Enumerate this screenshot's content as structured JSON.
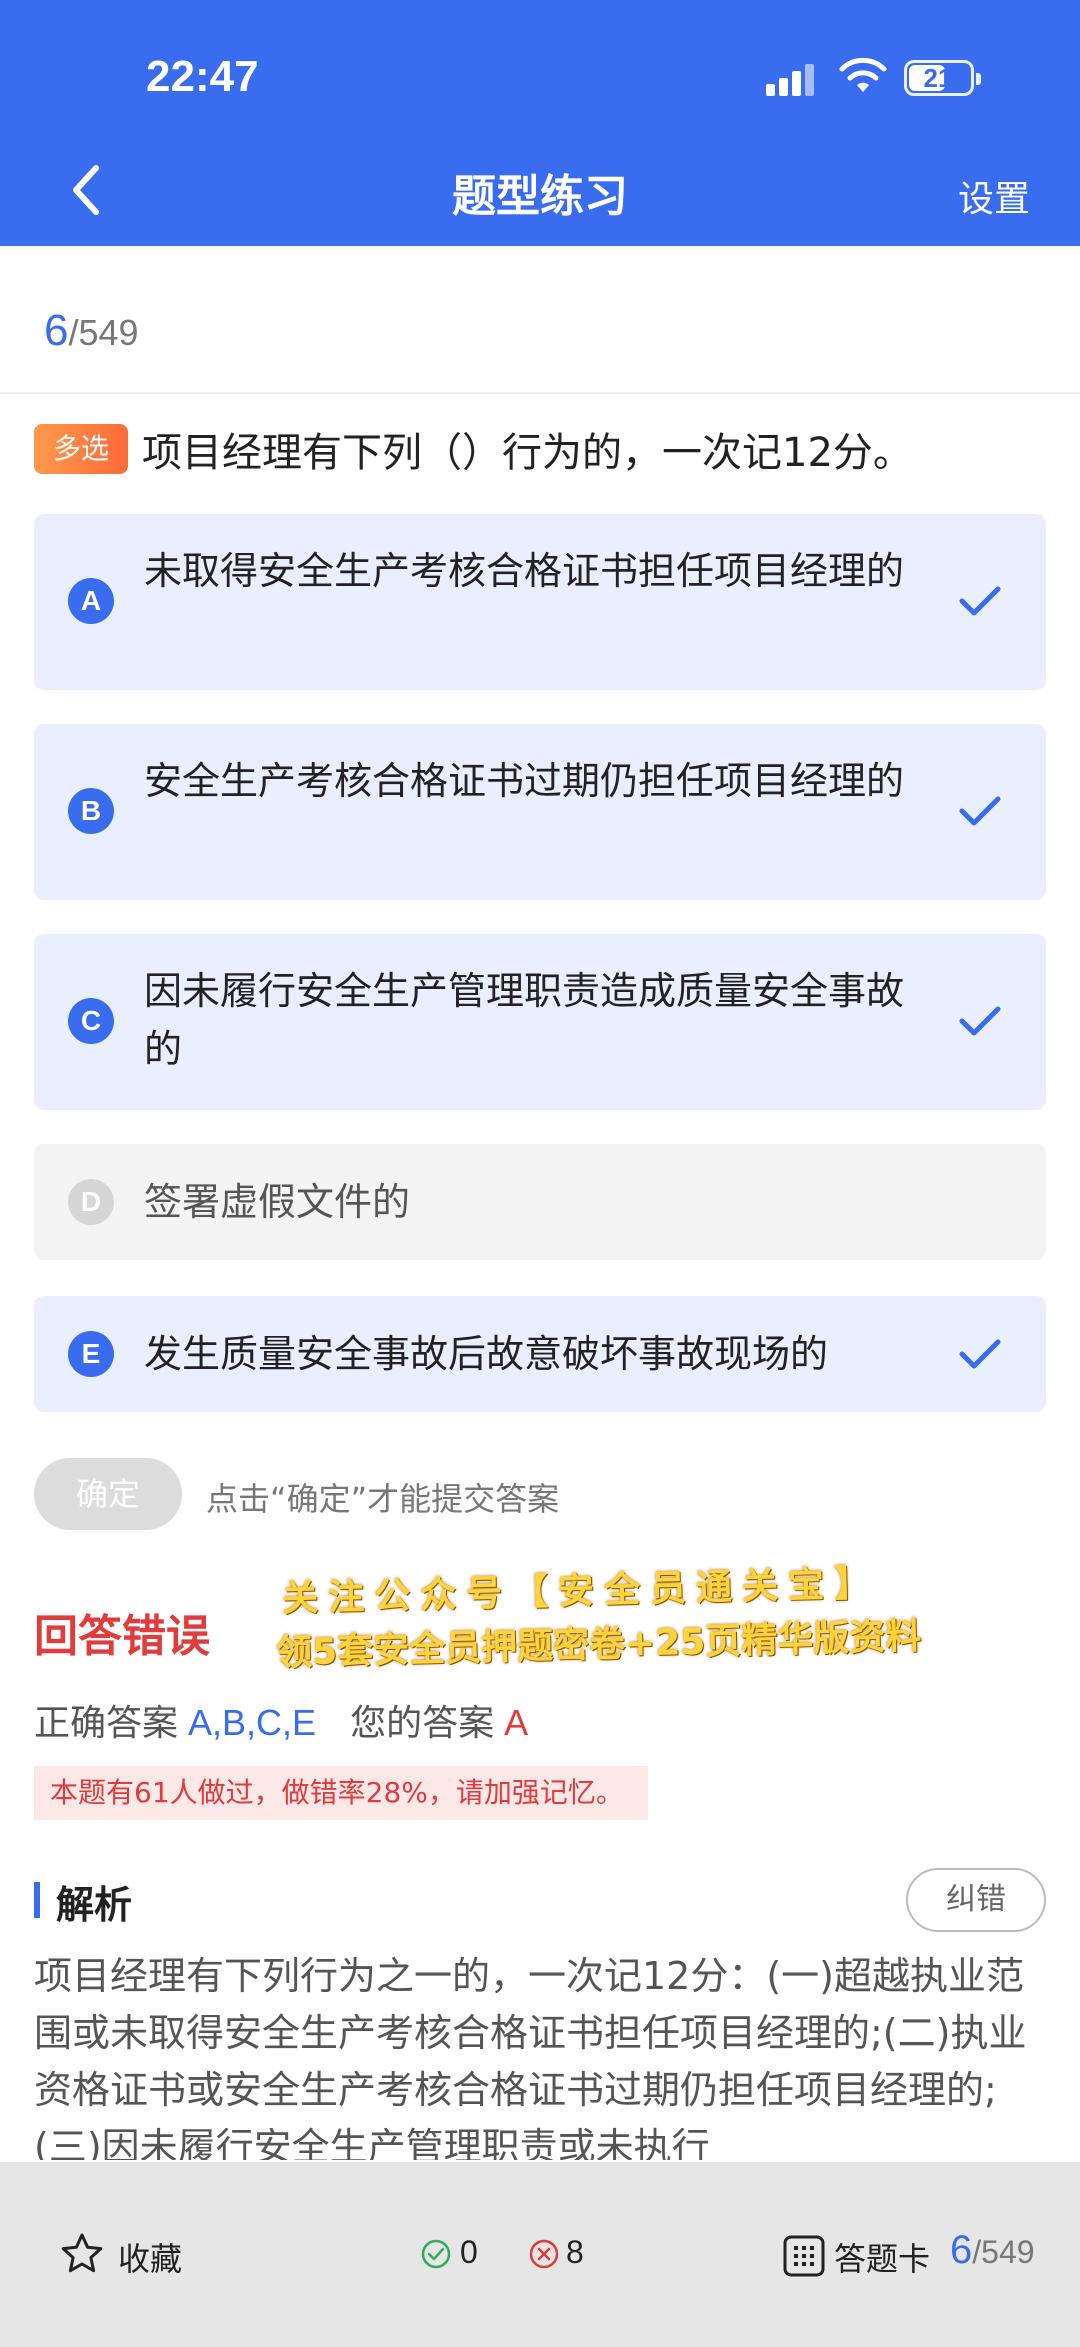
{
  "status": {
    "time": "22:47",
    "battery": "21"
  },
  "nav": {
    "title": "题型练习",
    "settings": "设置"
  },
  "progress": {
    "current": "6",
    "total": "/549"
  },
  "question": {
    "type": "多选",
    "text": "项目经理有下列（）行为的，一次记12分。",
    "options": [
      {
        "letter": "A",
        "text": "未取得安全生产考核合格证书担任项目经理的",
        "selected": true
      },
      {
        "letter": "B",
        "text": "安全生产考核合格证书过期仍担任项目经理的",
        "selected": true
      },
      {
        "letter": "C",
        "text": "因未履行安全生产管理职责造成质量安全事故的",
        "selected": true
      },
      {
        "letter": "D",
        "text": "签署虚假文件的",
        "selected": false
      },
      {
        "letter": "E",
        "text": "发生质量安全事故后故意破坏事故现场的",
        "selected": true
      }
    ]
  },
  "submit": {
    "button": "确定",
    "hint": "点击“确定”才能提交答案"
  },
  "result": {
    "title": "回答错误",
    "correct_label": "正确答案",
    "correct_value": "A,B,C,E",
    "mine_label": "您的答案",
    "mine_value": "A",
    "stat": "本题有61人做过，做错率28%，请加强记忆。"
  },
  "promo": {
    "line1": "关注公众号【安全员通关宝】",
    "line2": "领5套安全员押题密卷+25页精华版资料"
  },
  "analysis": {
    "title": "解析",
    "correct_button": "纠错",
    "text": "项目经理有下列行为之一的，一次记12分：(一)超越执业范围或未取得安全生产考核合格证书担任项目经理的;(二)执业资格证书或安全生产考核合格证书过期仍担任项目经理的;(三)因未履行安全生产管理职责或未执行"
  },
  "bottom": {
    "favorite": "收藏",
    "correct_count": "0",
    "wrong_count": "8",
    "answer_card": "答题卡",
    "current": "6",
    "total": "/549"
  },
  "colors": {
    "primary": "#3a6cf0",
    "error": "#e23b3b",
    "badge": "#ff7a3a"
  }
}
